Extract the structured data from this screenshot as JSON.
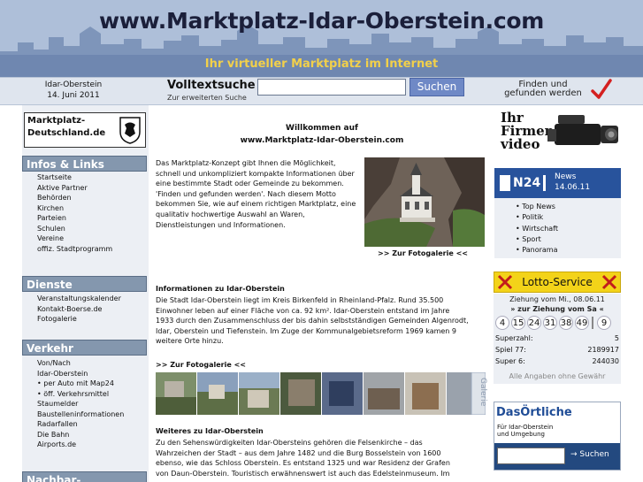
{
  "header": {
    "site_title": "www.Marktplatz-Idar-Oberstein.com",
    "subtitle": "Ihr virtueller Marktplatz im Internet"
  },
  "infobar": {
    "city": "Idar-Oberstein",
    "date": "14. Juni 2011",
    "search_title": "Volltextsuche",
    "search_link": "Zur erweiterten Suche",
    "search_value": "",
    "search_button": "Suchen",
    "slogan_line1": "Finden und",
    "slogan_line2": "gefunden werden"
  },
  "left": {
    "logo_line1": "Marktplatz-",
    "logo_line2": "Deutschland.de",
    "sections": [
      {
        "title": "Infos & Links",
        "items": [
          "Startseite",
          "Aktive Partner",
          "Behörden",
          "Kirchen",
          "Parteien",
          "Schulen",
          "Vereine",
          "offiz. Stadtprogramm"
        ]
      },
      {
        "title": "Dienste",
        "items": [
          "Veranstaltungskalender",
          "Kontakt-Boerse.de",
          "Fotogalerie"
        ]
      },
      {
        "title": "Verkehr",
        "items": [
          "Von/Nach",
          "Idar-Oberstein",
          "• per Auto mit Map24",
          "• öff. Verkehrsmittel",
          "Staumelder",
          "Baustelleninformationen",
          "Radarfallen",
          "Die Bahn",
          "Airports.de"
        ]
      },
      {
        "title": "Nachbar-Marktplätze",
        "items": []
      }
    ]
  },
  "main": {
    "welcome_line1": "Willkommen auf",
    "welcome_line2": "www.Marktplatz-Idar-Oberstein.com",
    "intro": [
      "Das Marktplatz-Konzept gibt Ihnen die Möglichkeit,",
      "schnell und unkompliziert kompakte Informationen über",
      "eine bestimmte Stadt oder Gemeinde zu bekommen.",
      "'Finden und gefunden werden'. Nach diesem Motto",
      "bekommen Sie, wie auf einem richtigen Marktplatz, eine",
      "qualitativ hochwertige Auswahl an Waren,",
      "Dienstleistungen und Informationen."
    ],
    "gallery_link_1": ">> Zur Fotogalerie <<",
    "info_heading": "Informationen zu Idar-Oberstein",
    "info_text": [
      "Die Stadt Idar-Oberstein liegt im Kreis Birkenfeld in Rheinland-Pfalz. Rund 35.500",
      "Einwohner leben auf einer Fläche von ca. 92 km². Idar-Oberstein entstand im Jahre",
      "1933 durch den Zusammenschluss der bis dahin selbstständigen Gemeinden Algenrodt,",
      "Idar, Oberstein und Tiefenstein. Im Zuge der Kommunalgebietsreform 1969 kamen 9",
      "weitere Orte hinzu."
    ],
    "gallery_link_2": ">> Zur Fotogalerie <<",
    "gallery_strip_label": "Galerie",
    "more_heading": "Weiteres zu Idar-Oberstein",
    "more_text": [
      "Zu den Sehenswürdigkeiten Idar-Obersteins gehören die Felsenkirche – das",
      "Wahrzeichen der Stadt – aus dem Jahre 1482 und die Burg Bosselstein von 1600",
      "ebenso, wie das Schloss Oberstein. Es entstand 1325 und war Residenz der Grafen",
      "von Daun-Oberstein. Touristisch erwähnenswert ist auch das Edelsteinmuseum. Im"
    ]
  },
  "right": {
    "firmen_line1": "Ihr",
    "firmen_line2": "Firmen-",
    "firmen_line3": "video",
    "n24_logo": "N24",
    "n24_news": "News",
    "n24_date": "14.06.11",
    "n24_items": [
      "• Top News",
      "• Politik",
      "• Wirtschaft",
      "• Sport",
      "• Panorama"
    ],
    "lotto_title": "Lotto-Service",
    "lotto_draw_line1": "Ziehung vom Mi., 08.06.11",
    "lotto_draw_line2": "» zur Ziehung vom Sa «",
    "lotto_numbers": [
      "4",
      "15",
      "24",
      "31",
      "38",
      "49",
      "9"
    ],
    "lotto_rows": [
      {
        "label": "Superzahl:",
        "value": "5"
      },
      {
        "label": "Spiel 77:",
        "value": "2189917"
      },
      {
        "label": "Super 6:",
        "value": "244030"
      }
    ],
    "lotto_note": "Alle Angaben ohne Gewähr",
    "ortliche_logo": "DasÖrtliche",
    "ortliche_sub1": "Für Idar-Oberstein",
    "ortliche_sub2": "und Umgebung",
    "ortliche_button": "→ Suchen"
  },
  "colors": {
    "banner_bg": "#aebfd9",
    "title_color": "#1b1f3a",
    "subtitle_color": "#f2d04a",
    "nav_header": "#8497ae",
    "panel_bg": "#eceff4",
    "n24_blue": "#28539c",
    "lotto_yellow": "#f3d319",
    "check_red": "#d42020"
  }
}
